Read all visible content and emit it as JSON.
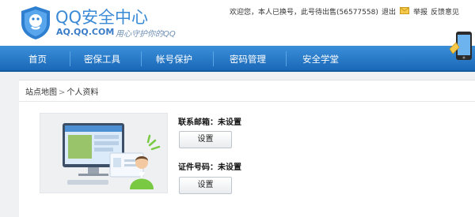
{
  "header": {
    "title": "QQ安全中心",
    "url": "AQ.QQ.COM",
    "slogan": "用心守护你的QQ",
    "welcome": "欢迎您，本人已换号，此号待出售(56577558)",
    "logout": "退出",
    "report": "举报",
    "feedback": "反馈意见"
  },
  "nav": {
    "items": [
      {
        "label": "首页"
      },
      {
        "label": "密保工具"
      },
      {
        "label": "帐号保护"
      },
      {
        "label": "密码管理"
      },
      {
        "label": "安全学堂"
      }
    ]
  },
  "breadcrumb": {
    "home": "站点地图",
    "separator": ">",
    "current": "个人资料"
  },
  "profile": {
    "email_label": "联系邮箱：未设置",
    "email_button": "设置",
    "id_label": "证件号码：未设置",
    "id_button": "设置"
  },
  "colors": {
    "brand_blue": "#3a8ad6",
    "nav_blue": "#1f73c2",
    "accent_green": "#7ac943"
  },
  "icons": [
    "shield-logo-icon",
    "mail-icon",
    "phone-icon"
  ]
}
